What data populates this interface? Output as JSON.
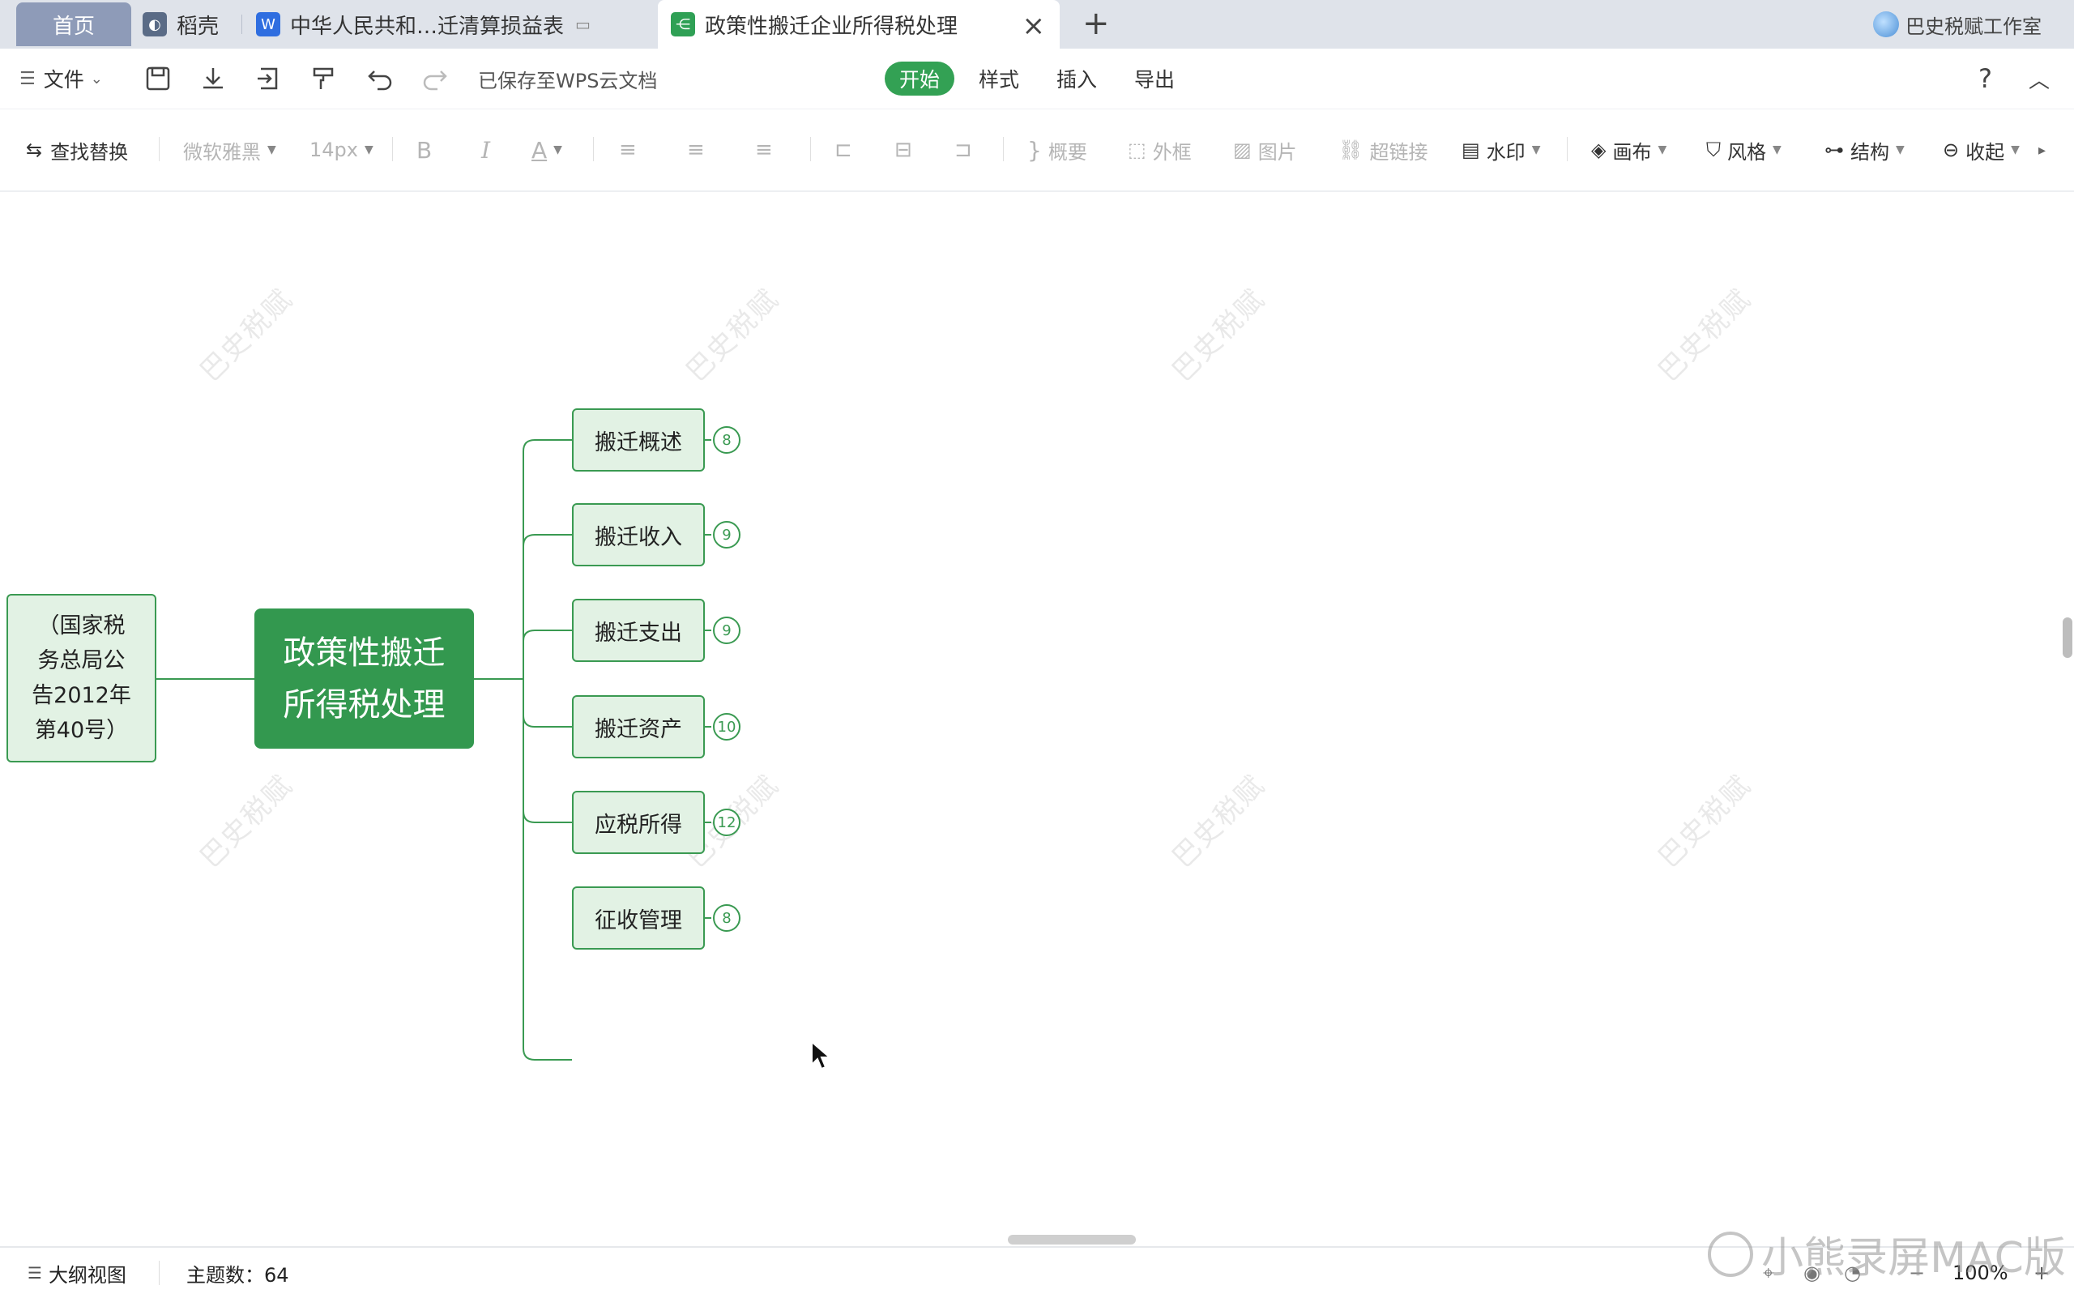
{
  "tabs": {
    "home": "首页",
    "daoke": "稻壳",
    "doc": "中华人民共和…迁清算损益表",
    "active": "政策性搬迁企业所得税处理",
    "account": "巴史税赋工作室"
  },
  "menubar": {
    "file": "文件",
    "saved_status": "已保存至WPS云文档",
    "ribbon_tabs": [
      "开始",
      "样式",
      "插入",
      "导出"
    ],
    "help": "?"
  },
  "toolbar": {
    "find_replace": "查找替换",
    "font": "微软雅黑",
    "font_size": "14px",
    "bold": "B",
    "italic": "I",
    "font_color": "A",
    "summary": "概要",
    "frame": "外框",
    "image": "图片",
    "hyperlink": "超链接",
    "watermark": "水印",
    "canvas": "画布",
    "style": "风格",
    "structure": "结构",
    "collapse": "收起"
  },
  "mindmap": {
    "root": [
      "政策性搬迁",
      "所得税处理"
    ],
    "left_node": [
      "（国家税",
      "务总局公",
      "告2012年",
      "第40号）"
    ],
    "children": [
      {
        "label": "搬迁概述",
        "count": "8"
      },
      {
        "label": "搬迁收入",
        "count": "9"
      },
      {
        "label": "搬迁支出",
        "count": "9"
      },
      {
        "label": "搬迁资产",
        "count": "10"
      },
      {
        "label": "应税所得",
        "count": "12"
      },
      {
        "label": "征收管理",
        "count": "8"
      }
    ],
    "watermark": "巴史税赋",
    "line_color": "#3a9a52",
    "root_color": "#33984f",
    "node_fill": "#e2f2e4"
  },
  "statusbar": {
    "outline_view": "大纲视图",
    "topic_count": "主题数：64",
    "zoom": "100%",
    "recorder": "小熊录屏MAC版"
  }
}
